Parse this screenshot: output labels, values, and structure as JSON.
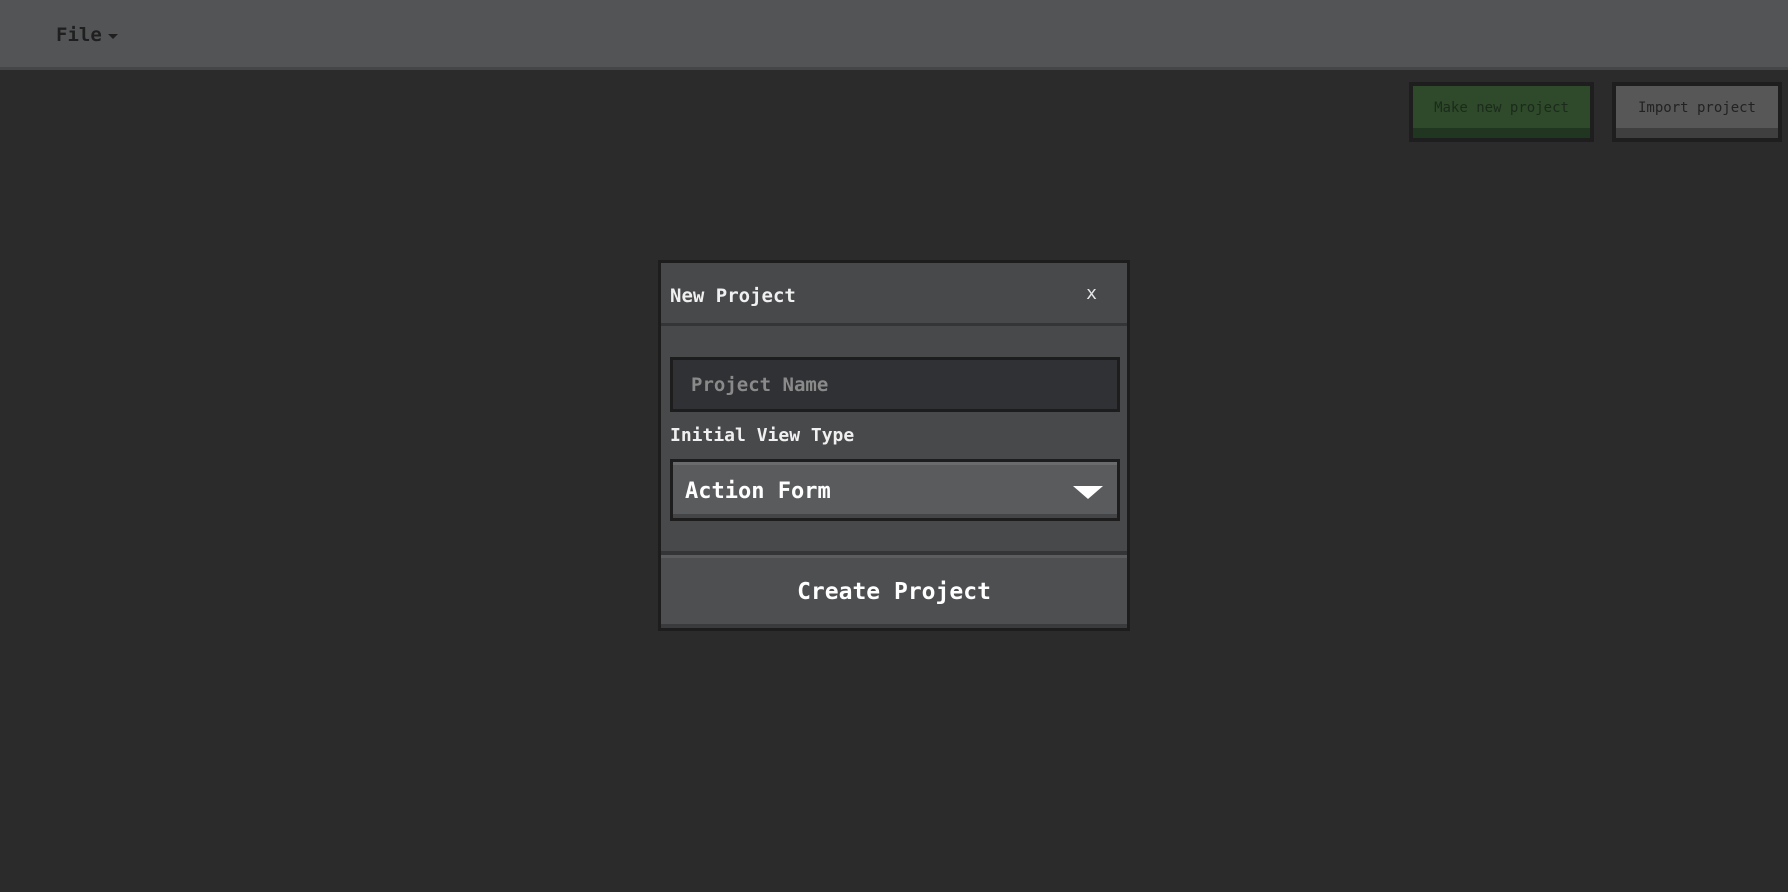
{
  "menubar": {
    "file_label": "File"
  },
  "toolbar": {
    "make_new_project_label": "Make new project",
    "import_project_label": "Import project"
  },
  "dialog": {
    "title": "New Project",
    "close_glyph": "x",
    "project_name": {
      "value": "",
      "placeholder": "Project Name"
    },
    "view_type_label": "Initial View Type",
    "view_type_selected": "Action Form",
    "create_label": "Create Project"
  },
  "icons": {
    "close": "close-icon",
    "dropdown": "chevron-down-icon",
    "file_caret": "caret-down-icon"
  },
  "colors": {
    "background": "#2b2b2b",
    "topbar": "#535456",
    "dialog": "#48494b",
    "make_new_project": "#2e4a2a"
  }
}
